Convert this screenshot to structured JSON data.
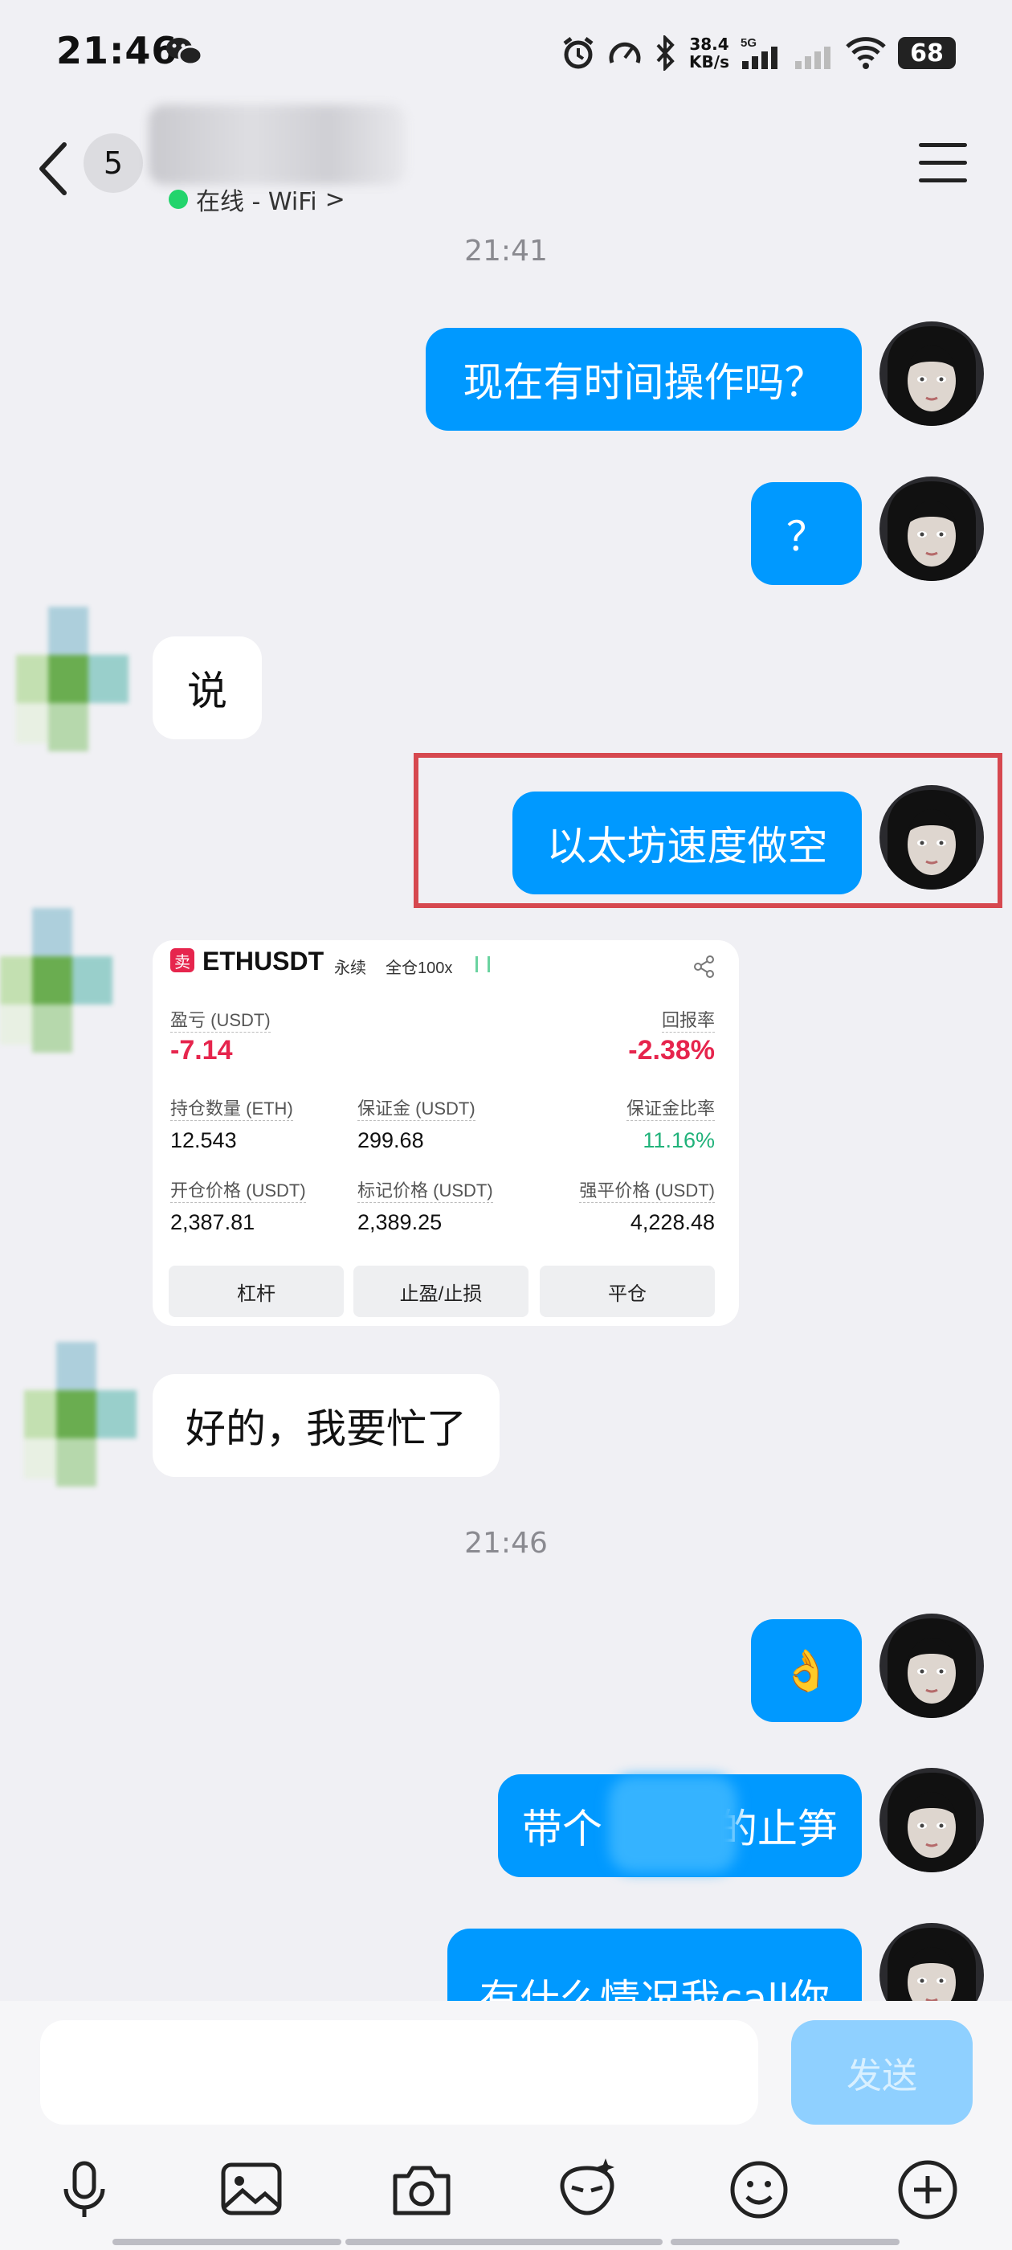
{
  "status": {
    "time": "21:46",
    "net_speed_top": "38.4",
    "net_speed_bottom": "KB/s",
    "network": "5G",
    "battery": "68"
  },
  "header": {
    "unread_count": "5",
    "online_status": "在线 - WiFi",
    "online_chevron": ">"
  },
  "timestamps": [
    "21:41",
    "21:46"
  ],
  "messages": [
    {
      "side": "me",
      "text": "现在有时间操作吗？"
    },
    {
      "side": "me",
      "text": "？"
    },
    {
      "side": "them",
      "text": "说"
    },
    {
      "side": "me",
      "text": "以太坊速度做空"
    },
    {
      "side": "them",
      "type": "trade_card"
    },
    {
      "side": "them",
      "text": "好的，我要忙了"
    },
    {
      "side": "me",
      "text": "👌"
    },
    {
      "side": "me",
      "text_left": "带个",
      "text_right": "的止笋"
    },
    {
      "side": "me",
      "text": "有什么情况我call你"
    }
  ],
  "trade_card": {
    "logo_char": "卖",
    "symbol": "ETHUSDT",
    "contract_type": "永续",
    "margin_mode": "全仓100x",
    "pnl_label": "盈亏 (USDT)",
    "pnl_value": "-7.14",
    "roi_label": "回报率",
    "roi_value": "-2.38%",
    "position_label": "持仓数量 (ETH)",
    "position_value": "12.543",
    "margin_label": "保证金 (USDT)",
    "margin_value": "299.68",
    "margin_ratio_label": "保证金比率",
    "margin_ratio_value": "11.16%",
    "entry_label": "开仓价格 (USDT)",
    "entry_value": "2,387.81",
    "mark_label": "标记价格 (USDT)",
    "mark_value": "2,389.25",
    "liq_label": "强平价格 (USDT)",
    "liq_value": "4,228.48",
    "buttons": [
      "杠杆",
      "止盈/止损",
      "平仓"
    ]
  },
  "input": {
    "send_label": "发送"
  },
  "toolbar_icons": [
    "microphone-icon",
    "image-icon",
    "camera-icon",
    "sticker-icon",
    "emoji-icon",
    "plus-icon"
  ],
  "colors": {
    "bubble_me": "#0099ff",
    "bubble_them": "#ffffff",
    "background": "#f0f0f4",
    "negative": "#e6254d",
    "positive": "#20b27a",
    "highlight_box": "#d6484f"
  }
}
